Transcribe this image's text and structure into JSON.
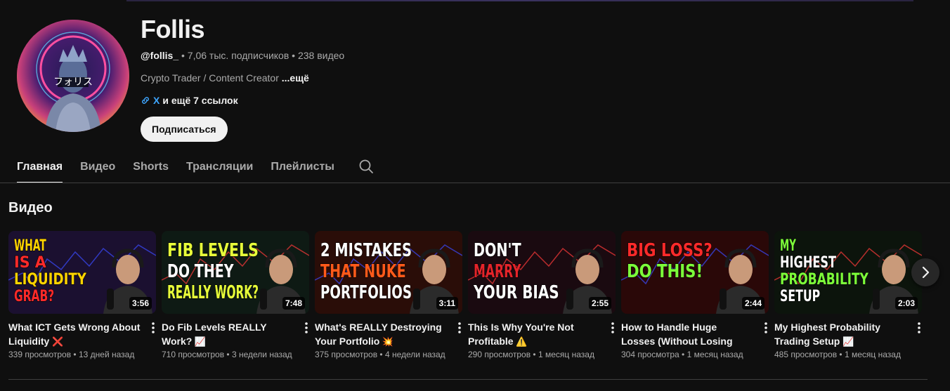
{
  "channel": {
    "name": "Follis",
    "handle": "@follis_",
    "subscribers": "• 7,06 тыс. подписчиков",
    "video_count": "• 238 видео",
    "description": "Crypto Trader / Content Creator",
    "description_more": "...ещё",
    "link_main": "X",
    "link_more": "и ещё 7 ссылок",
    "subscribe_label": "Подписаться",
    "avatar_text": "フォリス"
  },
  "tabs": [
    {
      "label": "Главная",
      "active": true
    },
    {
      "label": "Видео"
    },
    {
      "label": "Shorts"
    },
    {
      "label": "Трансляции"
    },
    {
      "label": "Плейлисты"
    }
  ],
  "section": {
    "title": "Видео"
  },
  "videos": [
    {
      "title": "What ICT Gets Wrong About Liquidity",
      "emoji": "❌",
      "views": "339 просмотров",
      "age": "13 дней назад",
      "duration": "3:56",
      "thumb_lines": [
        "WHAT",
        "IS A",
        "LIQUIDITY",
        "GRAB?"
      ],
      "colors": {
        "bg": "#1b1030",
        "accent": "#ffd400",
        "alt": "#ff2a2a"
      }
    },
    {
      "title": "Do Fib Levels REALLY Work?",
      "emoji": "📈",
      "views": "710 просмотров",
      "age": "3 недели назад",
      "duration": "7:48",
      "thumb_lines": [
        "FIB LEVELS",
        "DO THEY",
        "REALLY WORK?"
      ],
      "colors": {
        "bg": "#0e1a14",
        "accent": "#e8ff3a",
        "alt": "#ffffff"
      }
    },
    {
      "title": "What's REALLY Destroying Your Portfolio",
      "emoji": "💥",
      "views": "375 просмотров",
      "age": "4 недели назад",
      "duration": "3:11",
      "thumb_lines": [
        "2 MISTAKES",
        "THAT NUKE",
        "PORTFOLIOS"
      ],
      "colors": {
        "bg": "#2a0d08",
        "accent": "#ffffff",
        "alt": "#ff5a1a"
      }
    },
    {
      "title": "This Is Why You're Not Profitable",
      "emoji": "⚠️",
      "views": "290 просмотров",
      "age": "1 месяц назад",
      "duration": "2:55",
      "thumb_lines": [
        "DON'T",
        "MARRY",
        "YOUR BIAS"
      ],
      "colors": {
        "bg": "#1a0a10",
        "accent": "#ffffff",
        "alt": "#e4242a",
        "third": "#ffd400"
      }
    },
    {
      "title": "How to Handle Huge Losses (Without Losing Your Mind) ...",
      "emoji": "",
      "views": "304 просмотра",
      "age": "1 месяц назад",
      "duration": "2:44",
      "thumb_lines": [
        "BIG LOSS?",
        "DO THIS!"
      ],
      "colors": {
        "bg": "#2a0808",
        "accent": "#ff2a2a",
        "alt": "#7dff3a"
      }
    },
    {
      "title": "My Highest Probability Trading Setup",
      "emoji": "📈",
      "views": "485 просмотров",
      "age": "1 месяц назад",
      "duration": "2:03",
      "thumb_lines": [
        "MY",
        "HIGHEST",
        "PROBABILITY",
        "SETUP"
      ],
      "colors": {
        "bg": "#0c140c",
        "accent": "#7dff3a",
        "alt": "#ffffff"
      }
    }
  ]
}
